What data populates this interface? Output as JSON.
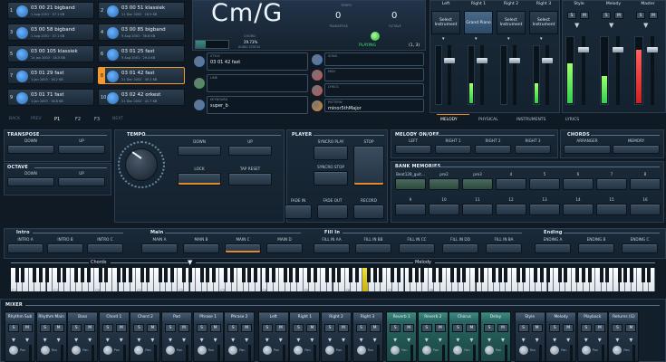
{
  "song_slots": [
    {
      "num": "1",
      "name": "03 00 21 bigband",
      "meta": "1 Aug 2001 · 37.1 KB",
      "selected": false
    },
    {
      "num": "2",
      "name": "03 00 51 klassiek",
      "meta": "11 Dec 2002 · 18.9 KB",
      "selected": false
    },
    {
      "num": "3",
      "name": "03 00 58 bigband",
      "meta": "1 Aug 2001 · 37.1 KB",
      "selected": false
    },
    {
      "num": "4",
      "name": "03 00 85 bigband",
      "meta": "9 Aug 2001 · 36.6 KB",
      "selected": false
    },
    {
      "num": "5",
      "name": "03 00 105 klassiek",
      "meta": "14 Jan 2003 · 18.5 KB",
      "selected": false
    },
    {
      "num": "6",
      "name": "03 01 25 fast",
      "meta": "9 Aug 2001 · 29.4 KB",
      "selected": false
    },
    {
      "num": "7",
      "name": "03 01 29 fast",
      "meta": "1 Jan 2003 · 16.2 KB",
      "selected": false
    },
    {
      "num": "8",
      "name": "03 01 42 fast",
      "meta": "21 Dec 2002 · 45.2 KB",
      "selected": true
    },
    {
      "num": "9",
      "name": "03 01 71 fast",
      "meta": "1 Jan 2003 · 18.8 KB",
      "selected": false
    },
    {
      "num": "10",
      "name": "03 02 42 orkest",
      "meta": "21 Dec 2002 · 41.7 KB",
      "selected": false
    }
  ],
  "song_nav": {
    "back": "BACK",
    "prev": "PREV",
    "f1": "P1",
    "f2": "F2",
    "f3": "F3",
    "next": "NEXT"
  },
  "chord": {
    "display": "Cm/G",
    "chord_label": "CHORD",
    "tempo_label": "TEMPO",
    "tempo_value": "0",
    "transpose_label": "TRANSPOSE",
    "octave_label": "OCTAVE",
    "octave_value": "0",
    "progress_pct": "29.73%",
    "progress_fraction": 0.2973,
    "progress_sub": "AUDIO STATUS",
    "status": "PLAYING",
    "position": "(1, 3)"
  },
  "info_fields": [
    {
      "label": "STYLE",
      "value": "03 01 42 fast",
      "color": "#3a7ad0"
    },
    {
      "label": "SONG",
      "value": "",
      "color": "#3a7ad0"
    },
    {
      "label": "LINK",
      "value": "",
      "color": "#3aa050"
    },
    {
      "label": "MIDI",
      "value": "",
      "color": "#d05050"
    },
    {
      "label": "KEYBOARD",
      "value": "super_b",
      "color": "#3a7ad0"
    },
    {
      "label": "LYRICS",
      "value": "",
      "color": "#d05050"
    },
    {
      "label": "PATTERN",
      "value": "minor5thMajor",
      "color": "#e08a2c"
    }
  ],
  "instrument_columns": [
    {
      "name": "Left",
      "instrument": "Select Instrument",
      "level": 0.0
    },
    {
      "name": "Right 1",
      "instrument": "Grand Piano",
      "level": 0.35
    },
    {
      "name": "Right 2",
      "instrument": "Select Instrument",
      "level": 0.0
    },
    {
      "name": "Right 3",
      "instrument": "Select Instrument",
      "level": 0.35
    }
  ],
  "top_mixer": [
    {
      "name": "Style",
      "level": 0.6
    },
    {
      "name": "Melody",
      "level": 0.4
    },
    {
      "name": "Master",
      "level": 0.8
    }
  ],
  "right_tabs": [
    "MELODY",
    "PHYSICAL",
    "INSTRUMENTS",
    "LYRICS"
  ],
  "sections": {
    "transpose": {
      "title": "TRANSPOSE",
      "down": "DOWN",
      "up": "UP"
    },
    "octave": {
      "title": "OCTAVE",
      "down": "DOWN",
      "up": "UP"
    },
    "tempo": {
      "title": "TEMPO",
      "down": "DOWN",
      "up": "UP",
      "lock": "LOCK",
      "tap": "TAP RESET"
    },
    "player": {
      "title": "PLAYER",
      "syncro_play": "SYNCRO PLAY",
      "syncro_stop": "SYNCRO STOP",
      "stop": "STOP",
      "fade_in": "FADE IN",
      "fade_out": "FADE OUT",
      "record": "RECORD"
    },
    "melody": {
      "title": "MELODY ON/OFF",
      "left": "LEFT",
      "right1": "RIGHT 1",
      "right2": "RIGHT 2",
      "right3": "RIGHT 3"
    },
    "chords": {
      "title": "CHORDS",
      "arranger": "ARRANGER",
      "memory": "MEMORY"
    },
    "bank": {
      "title": "BANK MEMORIES",
      "slots": [
        "Beat128_guit...",
        "pre2",
        "pre3",
        "4",
        "5",
        "6",
        "7",
        "8",
        "9",
        "10",
        "11",
        "12",
        "13",
        "14",
        "15",
        "16"
      ]
    },
    "intro": {
      "title": "Intro",
      "a": "INTRO A",
      "b": "INTRO B",
      "c": "INTRO C"
    },
    "main": {
      "title": "Main",
      "a": "MAIN A",
      "b": "MAIN B",
      "c": "MAIN C",
      "d": "MAIN D"
    },
    "fill": {
      "title": "Fill In",
      "aa": "FILL IN AA",
      "bb": "FILL IN BB",
      "cc": "FILL IN CC",
      "dd": "FILL IN DD",
      "ba": "FILL IN BA"
    },
    "ending": {
      "title": "Ending",
      "a": "ENDING A",
      "b": "ENDING B",
      "c": "ENDING C"
    }
  },
  "keyboard": {
    "chords_label": "Chords",
    "melody_label": "Melody",
    "octaves": [
      "C-2",
      "C-1",
      "C0",
      "C1",
      "C2",
      "C3",
      "C4",
      "C5",
      "C6",
      "C7",
      "C8"
    ]
  },
  "mixer": {
    "title": "MIXER",
    "solo": "S",
    "mute": "M",
    "pan": "Pan",
    "channels": [
      {
        "name": "Rhythm Sub",
        "teal": false
      },
      {
        "name": "Rhythm Main",
        "teal": false
      },
      {
        "name": "Bass",
        "teal": false
      },
      {
        "name": "Chord 1",
        "teal": false
      },
      {
        "name": "Chord 2",
        "teal": false
      },
      {
        "name": "Pad",
        "teal": false
      },
      {
        "name": "Phrase 1",
        "teal": false
      },
      {
        "name": "Phrase 2",
        "teal": false
      },
      {
        "name": "Left",
        "teal": false
      },
      {
        "name": "Right 1",
        "teal": false
      },
      {
        "name": "Right 2",
        "teal": false
      },
      {
        "name": "Right 3",
        "teal": false
      },
      {
        "name": "Reverb 1",
        "teal": true
      },
      {
        "name": "Reverb 2",
        "teal": true
      },
      {
        "name": "Chorus",
        "teal": true
      },
      {
        "name": "Delay",
        "teal": true
      },
      {
        "name": "Style",
        "teal": false
      },
      {
        "name": "Melody",
        "teal": false
      },
      {
        "name": "Playback",
        "teal": false
      },
      {
        "name": "Returns (G)",
        "teal": false
      },
      {
        "name": "Master",
        "teal": false
      }
    ]
  },
  "colors": {
    "accent": "#e08a2c",
    "playing": "#30d050",
    "teal": "#2a6a66"
  }
}
